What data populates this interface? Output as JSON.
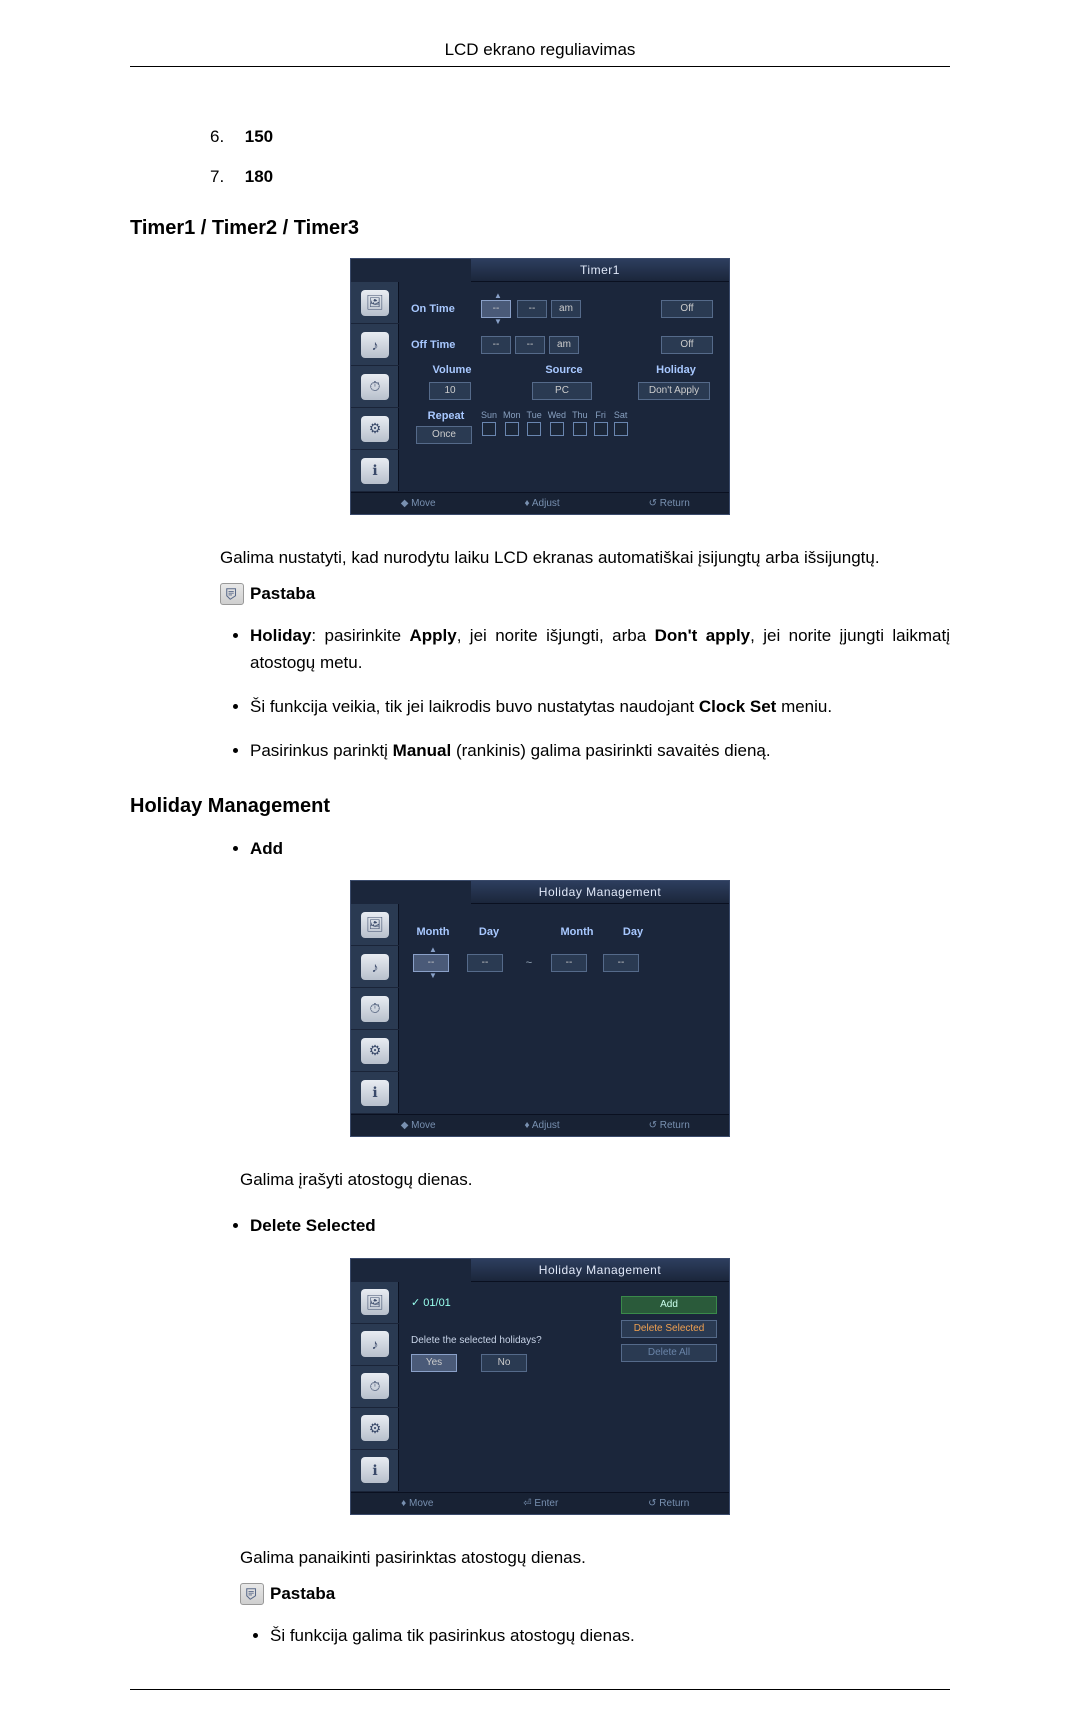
{
  "header": "LCD ekrano reguliavimas",
  "list": {
    "item6_num": "6.",
    "item6_val": "150",
    "item7_num": "7.",
    "item7_val": "180"
  },
  "section_timer": "Timer1 / Timer2 / Timer3",
  "timer_osd": {
    "title": "Timer1",
    "on_time": "On Time",
    "off_time": "Off Time",
    "dash": "--",
    "am": "am",
    "off": "Off",
    "volume": "Volume",
    "volume_val": "10",
    "source": "Source",
    "source_val": "PC",
    "holiday": "Holiday",
    "holiday_val": "Don't Apply",
    "repeat": "Repeat",
    "repeat_val": "Once",
    "days": [
      "Sun",
      "Mon",
      "Tue",
      "Wed",
      "Thu",
      "Fri",
      "Sat"
    ],
    "footer_move": "◆ Move",
    "footer_adjust": "♦ Adjust",
    "footer_return": "↺ Return"
  },
  "timer_desc": "Galima nustatyti, kad nurodytu laiku LCD ekranas automatiškai įsijungtų arba išsijungtų.",
  "note_label": "Pastaba",
  "timer_notes": {
    "b1_pre": "Holiday",
    "b1_mid1": ": pasirinkite ",
    "b1_apply": "Apply",
    "b1_mid2": ", jei norite išjungti, arba ",
    "b1_dont": "Don't apply",
    "b1_end": ", jei norite įjungti laikmatį atostogų metu.",
    "b2_pre": "Ši funkcija veikia, tik jei laikrodis buvo nustatytas naudojant ",
    "b2_bold": "Clock Set",
    "b2_end": " meniu.",
    "b3_pre": "Pasirinkus parinktį ",
    "b3_bold": "Manual",
    "b3_end": " (rankinis) galima pasirinkti savaitės dieną."
  },
  "section_holiday": "Holiday Management",
  "add_label": "Add",
  "hm_osd": {
    "title": "Holiday Management",
    "month": "Month",
    "day": "Day",
    "dash": "--",
    "tilde": "~",
    "footer_move": "◆ Move",
    "footer_adjust": "♦ Adjust",
    "footer_return": "↺ Return"
  },
  "hm_desc": "Galima įrašyti atostogų dienas.",
  "del_label": "Delete Selected",
  "del_osd": {
    "title": "Holiday Management",
    "date": "✓ 01/01",
    "add": "Add",
    "delete_selected": "Delete Selected",
    "delete_all": "Delete All",
    "prompt": "Delete the selected holidays?",
    "yes": "Yes",
    "no": "No",
    "footer_move": "♦ Move",
    "footer_enter": "⏎ Enter",
    "footer_return": "↺ Return"
  },
  "del_desc": "Galima panaikinti pasirinktas atostogų dienas.",
  "del_note": "Ši funkcija galima tik pasirinkus atostogų dienas."
}
